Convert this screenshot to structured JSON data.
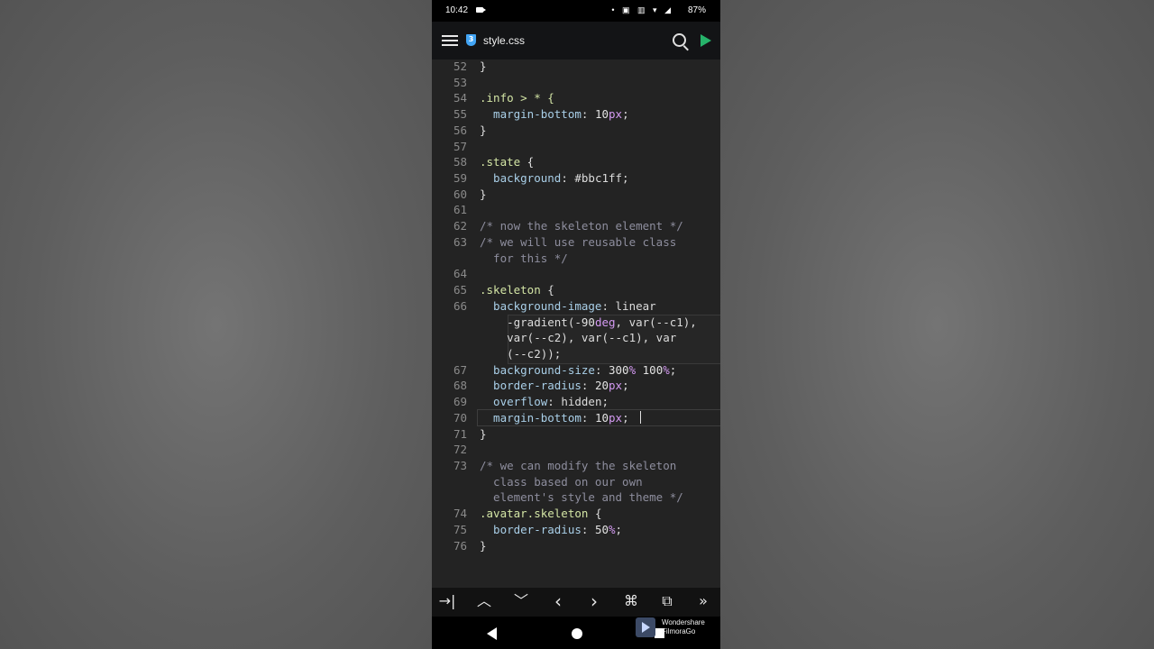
{
  "status_bar": {
    "time": "10:42",
    "battery": "87%",
    "icons": "• ▣ ▥ ▾ ◢"
  },
  "app_bar": {
    "filename": "style.css",
    "file_icon_label": "3"
  },
  "editor": {
    "lines": [
      {
        "n": "52",
        "tokens": [
          {
            "t": "}",
            "c": "plain"
          }
        ]
      },
      {
        "n": "53",
        "tokens": []
      },
      {
        "n": "54",
        "tokens": [
          {
            "t": ".info > * {",
            "c": "sel"
          }
        ]
      },
      {
        "n": "55",
        "tokens": [
          {
            "t": "  margin-bottom",
            "c": "prop"
          },
          {
            "t": ": ",
            "c": "plain"
          },
          {
            "t": "10",
            "c": "num"
          },
          {
            "t": "px",
            "c": "unit"
          },
          {
            "t": ";",
            "c": "plain"
          }
        ]
      },
      {
        "n": "56",
        "tokens": [
          {
            "t": "}",
            "c": "plain"
          }
        ]
      },
      {
        "n": "57",
        "tokens": []
      },
      {
        "n": "58",
        "tokens": [
          {
            "t": ".state",
            "c": "sel"
          },
          {
            "t": " {",
            "c": "plain"
          }
        ]
      },
      {
        "n": "59",
        "tokens": [
          {
            "t": "  background",
            "c": "prop"
          },
          {
            "t": ": #bbc1ff;",
            "c": "plain"
          }
        ]
      },
      {
        "n": "60",
        "tokens": [
          {
            "t": "}",
            "c": "plain"
          }
        ]
      },
      {
        "n": "61",
        "tokens": []
      },
      {
        "n": "62",
        "tokens": [
          {
            "t": "/* now the skeleton element */",
            "c": "cmt"
          }
        ]
      },
      {
        "n": "63",
        "tokens": [
          {
            "t": "/* we will use reusable class",
            "c": "cmt"
          }
        ]
      },
      {
        "n": "",
        "tokens": [
          {
            "t": "  for this */",
            "c": "cmt"
          }
        ]
      },
      {
        "n": "64",
        "tokens": []
      },
      {
        "n": "65",
        "tokens": [
          {
            "t": ".skeleton",
            "c": "sel"
          },
          {
            "t": " {",
            "c": "plain"
          }
        ]
      },
      {
        "n": "66",
        "tokens": [
          {
            "t": "  background-image",
            "c": "prop"
          },
          {
            "t": ": linear",
            "c": "plain"
          }
        ]
      },
      {
        "n": "",
        "tokens": [
          {
            "t": "    -gradient(",
            "c": "plain"
          },
          {
            "t": "-90",
            "c": "num"
          },
          {
            "t": "deg",
            "c": "unit"
          },
          {
            "t": ", var(--c1),",
            "c": "plain"
          }
        ]
      },
      {
        "n": "",
        "tokens": [
          {
            "t": "    var(--c2), var(--c1), var",
            "c": "plain"
          }
        ]
      },
      {
        "n": "",
        "tokens": [
          {
            "t": "    (--c2));",
            "c": "plain"
          }
        ]
      },
      {
        "n": "67",
        "tokens": [
          {
            "t": "  background-size",
            "c": "prop"
          },
          {
            "t": ": ",
            "c": "plain"
          },
          {
            "t": "300",
            "c": "num"
          },
          {
            "t": "%",
            "c": "unit"
          },
          {
            "t": " ",
            "c": "plain"
          },
          {
            "t": "100",
            "c": "num"
          },
          {
            "t": "%",
            "c": "unit"
          },
          {
            "t": ";",
            "c": "plain"
          }
        ]
      },
      {
        "n": "68",
        "tokens": [
          {
            "t": "  border-radius",
            "c": "prop"
          },
          {
            "t": ": ",
            "c": "plain"
          },
          {
            "t": "20",
            "c": "num"
          },
          {
            "t": "px",
            "c": "unit"
          },
          {
            "t": ";",
            "c": "plain"
          }
        ]
      },
      {
        "n": "69",
        "tokens": [
          {
            "t": "  overflow",
            "c": "prop"
          },
          {
            "t": ": hidden;",
            "c": "plain"
          }
        ]
      },
      {
        "n": "70",
        "tokens": [
          {
            "t": "  margin-bottom",
            "c": "prop"
          },
          {
            "t": ": ",
            "c": "plain"
          },
          {
            "t": "10",
            "c": "num"
          },
          {
            "t": "px",
            "c": "unit"
          },
          {
            "t": ";",
            "c": "plain"
          }
        ]
      },
      {
        "n": "71",
        "tokens": [
          {
            "t": "}",
            "c": "plain"
          }
        ]
      },
      {
        "n": "72",
        "tokens": []
      },
      {
        "n": "73",
        "tokens": [
          {
            "t": "/* we can modify the skeleton",
            "c": "cmt"
          }
        ]
      },
      {
        "n": "",
        "tokens": [
          {
            "t": "  class based on our own",
            "c": "cmt"
          }
        ]
      },
      {
        "n": "",
        "tokens": [
          {
            "t": "  element's style and theme */",
            "c": "cmt"
          }
        ]
      },
      {
        "n": "74",
        "tokens": [
          {
            "t": ".avatar.skeleton",
            "c": "sel"
          },
          {
            "t": " {",
            "c": "plain"
          }
        ]
      },
      {
        "n": "75",
        "tokens": [
          {
            "t": "  border-radius",
            "c": "prop"
          },
          {
            "t": ": ",
            "c": "plain"
          },
          {
            "t": "50",
            "c": "num"
          },
          {
            "t": "%",
            "c": "unit"
          },
          {
            "t": ";",
            "c": "plain"
          }
        ]
      },
      {
        "n": "76",
        "tokens": [
          {
            "t": "}",
            "c": "plain"
          }
        ]
      }
    ]
  },
  "toolbar": {
    "tab": "→|",
    "up": "︿",
    "down": "﹀",
    "left": "‹",
    "right": "›",
    "cmd": "⌘",
    "gamepad": "⧉",
    "more": "»"
  },
  "watermark": {
    "line1": "Wondershare",
    "line2": "FilmoraGo"
  },
  "colors": {
    "run": "#26b36a",
    "css_icon": "#42a5f5",
    "editor_bg": "#232323"
  }
}
